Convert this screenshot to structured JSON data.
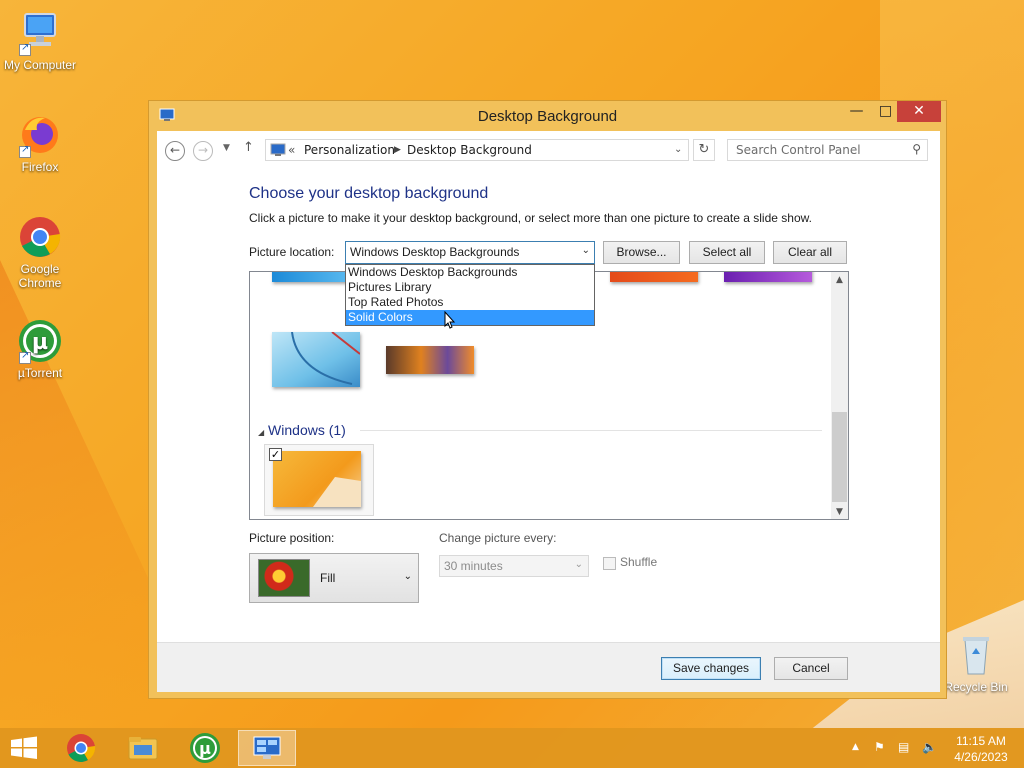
{
  "desktop": {
    "icons": [
      {
        "label": "My Computer"
      },
      {
        "label": "Firefox"
      },
      {
        "label": "Google Chrome"
      },
      {
        "label": "µTorrent"
      },
      {
        "label": "Recycle Bin"
      }
    ]
  },
  "window": {
    "title": "Desktop Background",
    "breadcrumb": {
      "prefix": "«",
      "items": [
        "Personalization",
        "Desktop Background"
      ]
    },
    "search_placeholder": "Search Control Panel",
    "heading": "Choose your desktop background",
    "instructions": "Click a picture to make it your desktop background, or select more than one picture to create a slide show.",
    "picture_location_label": "Picture location:",
    "picture_location_value": "Windows Desktop Backgrounds",
    "picture_location_options": [
      "Windows Desktop Backgrounds",
      "Pictures Library",
      "Top Rated Photos",
      "Solid Colors"
    ],
    "highlighted_option": "Solid Colors",
    "buttons": {
      "browse": "Browse...",
      "select_all": "Select all",
      "clear_all": "Clear all",
      "save": "Save changes",
      "cancel": "Cancel"
    },
    "group_header": "Windows (1)",
    "picture_position_label": "Picture position:",
    "picture_position_value": "Fill",
    "change_picture_label": "Change picture every:",
    "change_picture_value": "30 minutes",
    "shuffle_label": "Shuffle"
  },
  "taskbar": {
    "clock_time": "11:15 AM",
    "clock_date": "4/26/2023"
  },
  "colors": {
    "accent": "#3399ff",
    "heading": "#1e3287",
    "close": "#c7413a"
  }
}
